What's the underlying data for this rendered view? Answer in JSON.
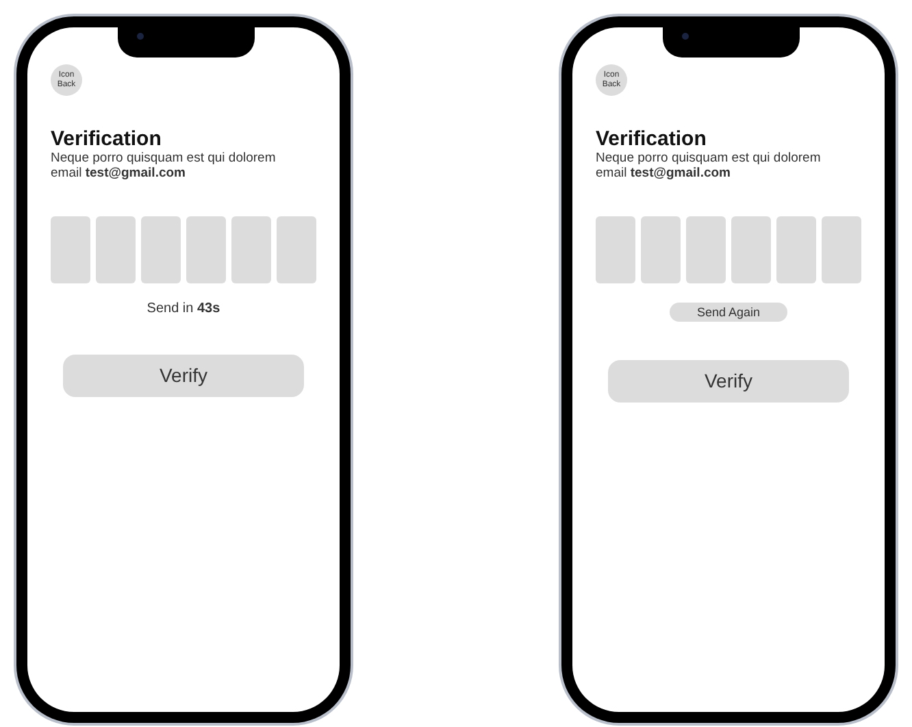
{
  "phones": [
    {
      "kind": "countdown",
      "back_button": "Icon Back",
      "title": "Verification",
      "subtitle": "Neque porro quisquam est qui dolorem email **test@gmail.com**",
      "resend": "Send in **43s**",
      "verify_button": "Verify"
    },
    {
      "kind": "resend",
      "back_button": "Icon Back",
      "title": "Verification",
      "subtitle": "Neque porro quisquam est qui dolorem email **test@gmail.com**",
      "resend": "Send Again",
      "verify_button": "Verify"
    }
  ]
}
